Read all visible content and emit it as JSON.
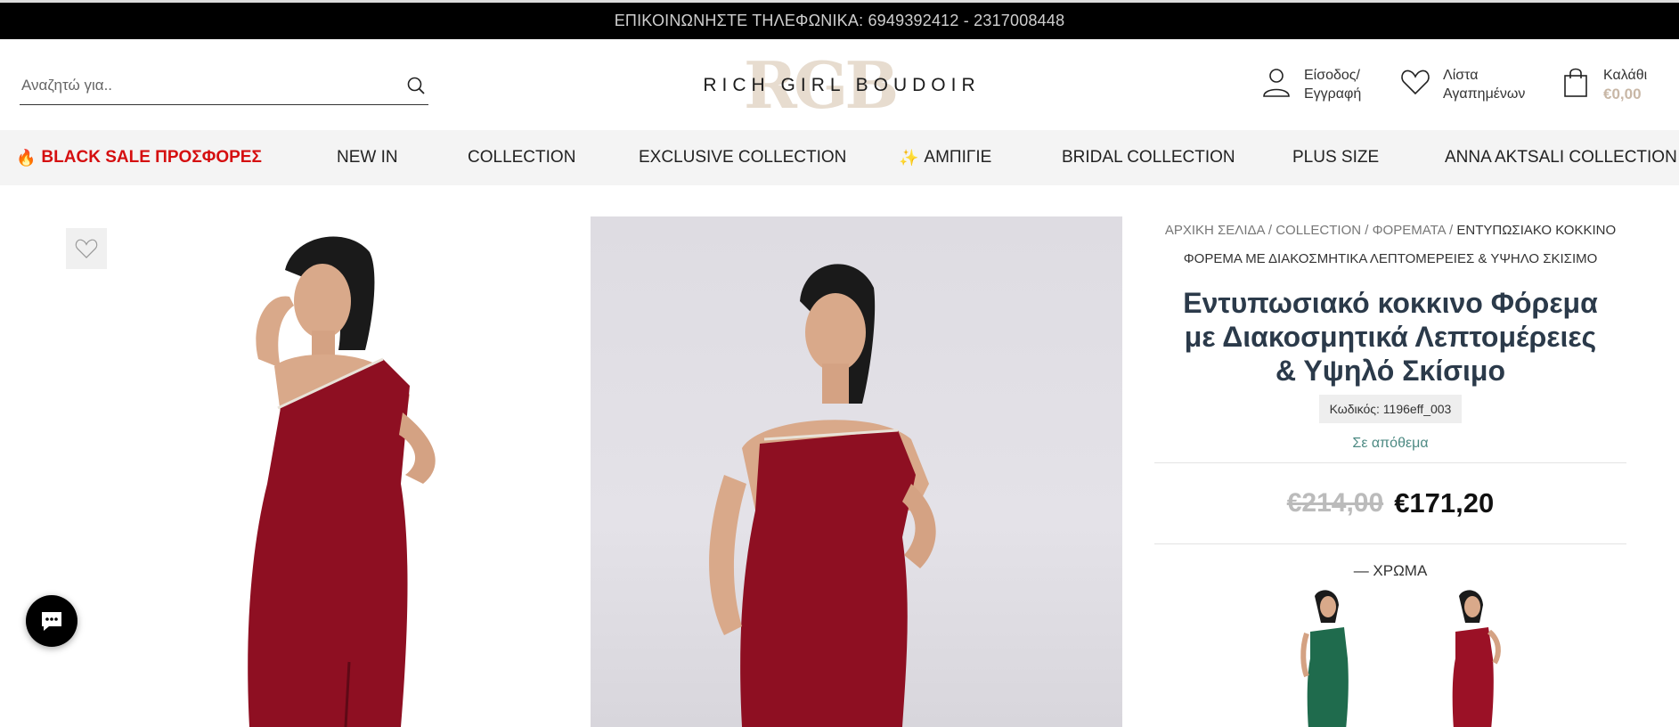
{
  "topbar": {
    "text": "ΕΠΙΚΟΙΝΩΝΗΣΤΕ ΤΗΛΕΦΩΝΙΚΑ: 6949392412 - 2317008448"
  },
  "header": {
    "search_placeholder": "Αναζητώ για..",
    "logo_monogram": "RGB",
    "logo_text": "RICH GIRL BOUDOIR",
    "login_line1": "Είσοδος/",
    "login_line2": "Εγγραφή",
    "wishlist_line1": "Λίστα",
    "wishlist_line2": "Αγαπημένων",
    "cart_label": "Καλάθι",
    "cart_total": "€0,00"
  },
  "nav": {
    "items": [
      {
        "label": "BLACK SALE ΠΡΟΣΦΟΡΕΣ",
        "emoji": "🔥"
      },
      {
        "label": "NEW IN"
      },
      {
        "label": "COLLECTION"
      },
      {
        "label": "EXCLUSIVE COLLECTION"
      },
      {
        "label": "ΑΜΠΙΓΙΕ",
        "emoji": "✨"
      },
      {
        "label": "BRIDAL COLLECTION"
      },
      {
        "label": "PLUS SIZE"
      },
      {
        "label": "ANNA AKTSALI COLLECTION"
      }
    ]
  },
  "product": {
    "breadcrumb": {
      "home": "ΑΡΧΙΚΗ ΣΕΛΙΔΑ",
      "collection": "COLLECTION",
      "dresses": "ΦΟΡΕΜΑΤΑ",
      "sep": "/",
      "current_line1": "ΕΝΤΥΠΩΣΙΑΚΟ ΚΟΚΚΙΝΟ",
      "current_line2": "ΦΟΡΕΜΑ ΜΕ ΔΙΑΚΟΣΜΗΤΙΚΑ ΛΕΠΤΟΜΕΡΕΙΕΣ & ΥΨΗΛΟ ΣΚΙΣΙΜΟ"
    },
    "title": "Εντυπωσιακό κοκκινο Φόρεμα με Διακοσμητικά Λεπτομέρειες & Υψηλό Σκίσιμο",
    "sku": "Κωδικός: 1196eff_003",
    "stock": "Σε απόθεμα",
    "old_price": "€214,00",
    "new_price": "€171,20",
    "color_label": "— ΧΡΩΜΑ",
    "swatches": [
      {
        "name": "green",
        "color": "#1f6b4d"
      },
      {
        "name": "red",
        "color": "#9b1126"
      }
    ]
  },
  "colors": {
    "sale_red": "#d50f10",
    "dress_red": "#8e0f22",
    "logo_beige": "#e7dccf",
    "stock_green": "#4d8a83"
  },
  "icons": [
    "search-icon",
    "user-icon",
    "heart-icon",
    "bag-icon",
    "chat-icon"
  ]
}
